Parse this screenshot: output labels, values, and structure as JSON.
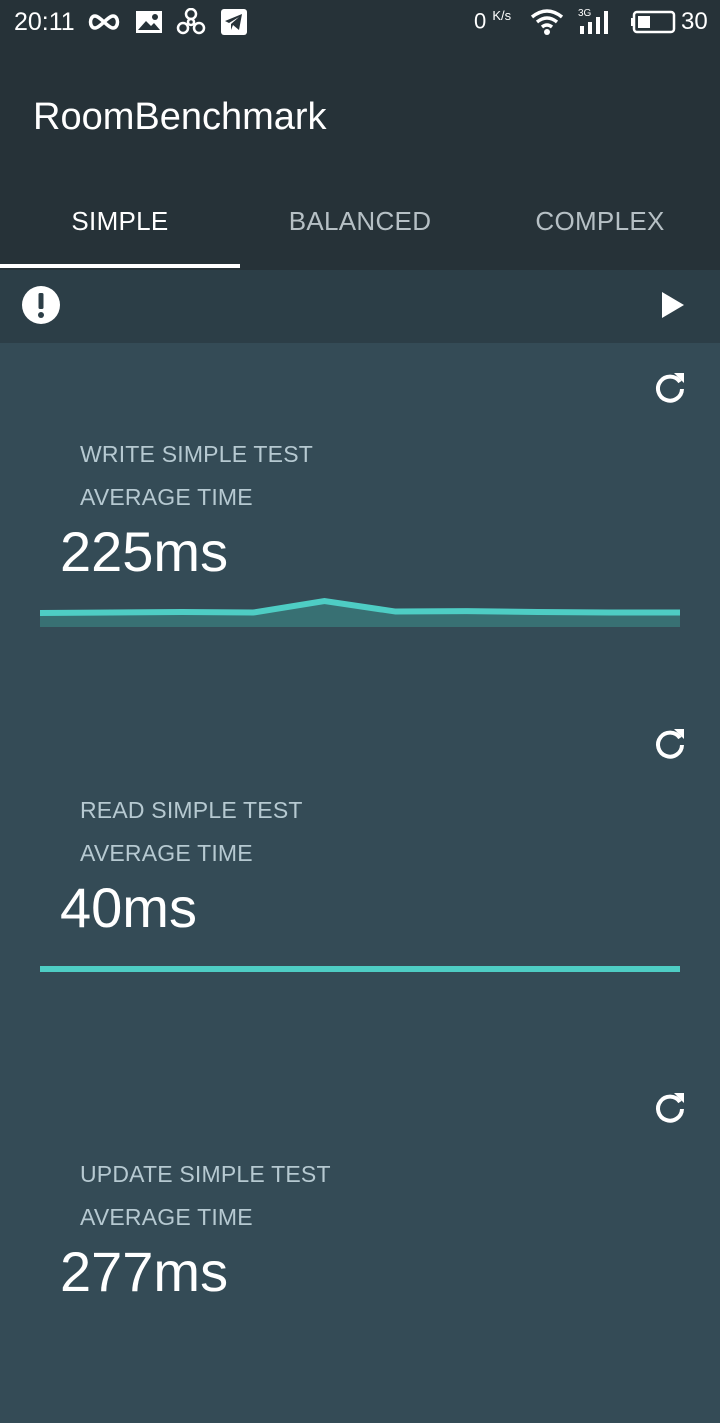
{
  "status_bar": {
    "time": "20:11",
    "net_speed": "0",
    "net_speed_unit": "K/s",
    "network_type": "3G",
    "battery_level": "30",
    "icons": [
      "infinity-icon",
      "image-notification-icon",
      "fan-icon",
      "telegram-icon",
      "wifi-icon",
      "signal-icon",
      "battery-icon"
    ]
  },
  "app": {
    "title": "RoomBenchmark"
  },
  "tabs": [
    {
      "label": "SIMPLE",
      "active": true
    },
    {
      "label": "BALANCED",
      "active": false
    },
    {
      "label": "COMPLEX",
      "active": false
    }
  ],
  "toolbar": {
    "icons": [
      "info-icon",
      "play-icon"
    ]
  },
  "tests": [
    {
      "name": "WRITE SIMPLE TEST",
      "avg_label": "AVERAGE TIME",
      "value": "225ms",
      "trend": [
        215,
        216,
        217,
        216,
        240,
        218,
        219,
        217,
        216,
        216
      ]
    },
    {
      "name": "READ SIMPLE TEST",
      "avg_label": "AVERAGE TIME",
      "value": "40ms",
      "trend": [
        40,
        40,
        40,
        40,
        40,
        40,
        40,
        40,
        40,
        40
      ]
    },
    {
      "name": "UPDATE SIMPLE TEST",
      "avg_label": "AVERAGE TIME",
      "value": "277ms"
    }
  ],
  "colors": {
    "app_bar": "#263238",
    "toolbar": "#2c3e47",
    "content_bg": "#344b56",
    "accent": "#4ecdc4",
    "accent_dark": "#3d8f8c",
    "label": "#b6c9d1"
  }
}
